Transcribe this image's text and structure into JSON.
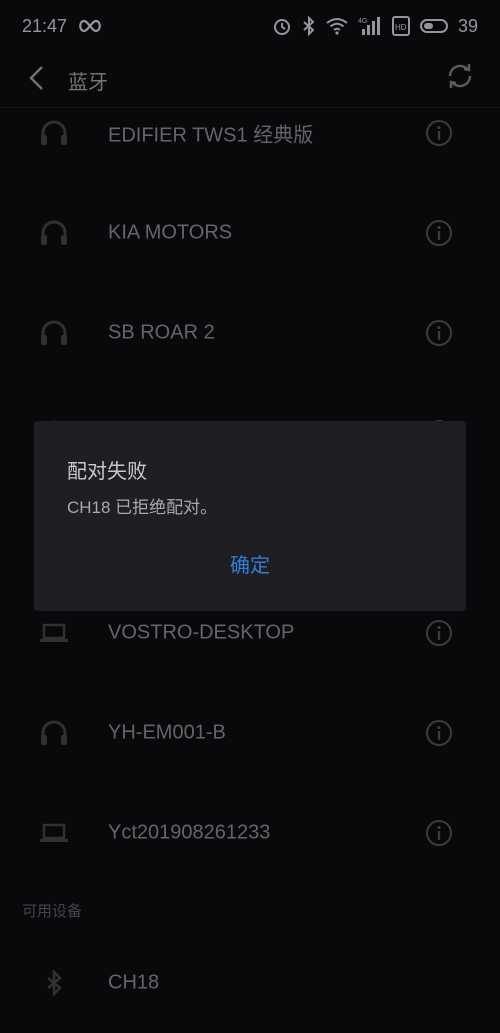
{
  "status_bar": {
    "time": "21:47",
    "battery": "39",
    "signal_tag": "4G",
    "hd_tag": "HD",
    "icons": [
      "infinity-icon",
      "alarm-icon",
      "bluetooth-icon",
      "wifi-icon",
      "signal-icon",
      "hd-icon",
      "battery-icon"
    ]
  },
  "header": {
    "title": "蓝牙",
    "back_icon": "chevron-left-icon",
    "refresh_icon": "refresh-icon"
  },
  "paired_devices": [
    {
      "name": "EDIFIER TWS1 经典版",
      "icon": "headphones-icon"
    },
    {
      "name": "KIA MOTORS",
      "icon": "headphones-icon"
    },
    {
      "name": "SB ROAR 2",
      "icon": "headphones-icon"
    },
    {
      "name": "",
      "icon": "headphones-icon"
    },
    {
      "name": "",
      "icon": "headphones-icon"
    },
    {
      "name": "VOSTRO-DESKTOP",
      "icon": "laptop-icon"
    },
    {
      "name": "YH-EM001-B",
      "icon": "headphones-icon"
    },
    {
      "name": "Yct201908261233",
      "icon": "laptop-icon"
    }
  ],
  "available_section": {
    "label": "可用设备",
    "devices": [
      {
        "name": "CH18",
        "icon": "bluetooth-icon"
      }
    ]
  },
  "dialog": {
    "title": "配对失败",
    "message": "CH18 已拒绝配对。",
    "confirm_label": "确定"
  },
  "colors": {
    "background": "#0b0b0e",
    "dialog_bg": "#1f1f23",
    "accent": "#2d7fd6"
  }
}
